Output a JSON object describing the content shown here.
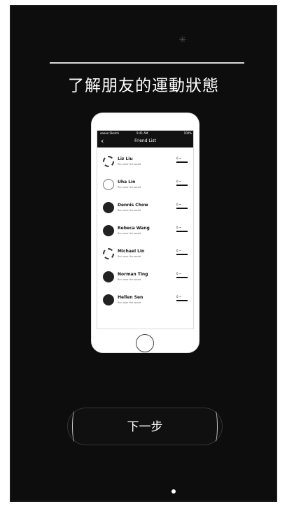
{
  "screen": {
    "heading": "了解朋友的運動狀態",
    "next_button_label": "下一步",
    "top_icon": "status-spark-icon",
    "page_indicator_count": 1,
    "colors": {
      "background": "#0d0d0d",
      "text": "#ffffff",
      "divider": "#d9d9d9",
      "phone": "#ffffff"
    }
  },
  "phone_mockup": {
    "status_bar": {
      "left": "ooooo Sketch",
      "center": "9:41 AM",
      "right": "100%"
    },
    "title": "Friend List",
    "back_icon": "chevron-left-icon",
    "home_icon": "home-button-icon",
    "friends": [
      {
        "name": "Liz Liu",
        "subtitle": "Run over the world",
        "metric": "0 ~"
      },
      {
        "name": "Uha Lin",
        "subtitle": "Run over the world",
        "metric": "0 ~"
      },
      {
        "name": "Dennis Chow",
        "subtitle": "Run over the world",
        "metric": "0 ~"
      },
      {
        "name": "Rebeca Wang",
        "subtitle": "Run over the world",
        "metric": "0 ~"
      },
      {
        "name": "Michael Lin",
        "subtitle": "Run over the world",
        "metric": "0 ~"
      },
      {
        "name": "Norman Ting",
        "subtitle": "Run over the world",
        "metric": "0 ~"
      },
      {
        "name": "Hellen Sen",
        "subtitle": "Run over the world",
        "metric": "0 ~"
      }
    ]
  }
}
